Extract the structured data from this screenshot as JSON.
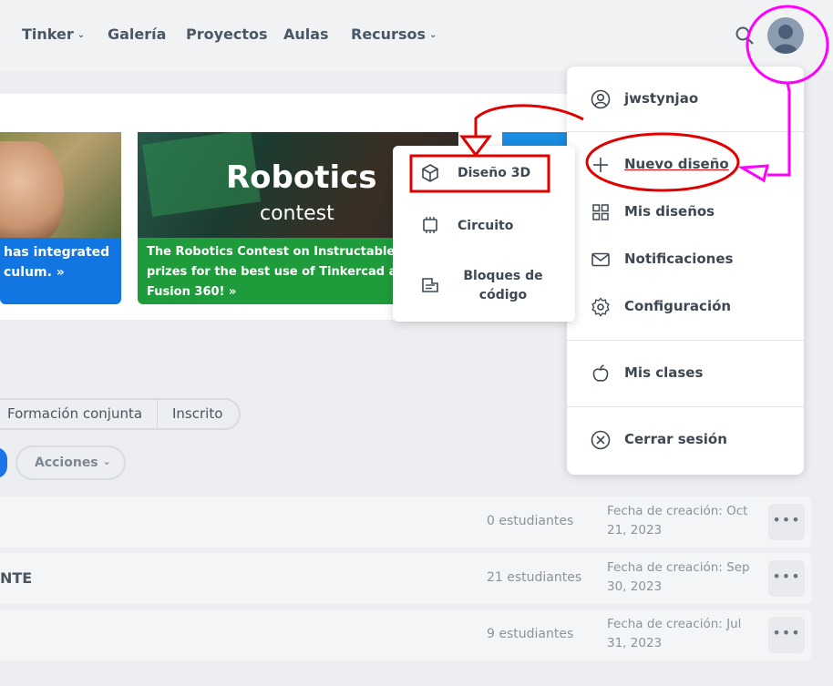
{
  "nav": {
    "items": [
      {
        "label": "Tinker",
        "has_chevron": true
      },
      {
        "label": "Galería",
        "has_chevron": false
      },
      {
        "label": "Proyectos",
        "has_chevron": false
      },
      {
        "label": "Aulas",
        "has_chevron": false
      },
      {
        "label": "Recursos",
        "has_chevron": true
      }
    ],
    "search_icon": "search-icon",
    "avatar_icon": "user-avatar"
  },
  "banners": {
    "card1": {
      "caption": "has integrated culum. »"
    },
    "card2": {
      "title": "Robotics",
      "subtitle": "contest",
      "caption": "The Robotics Contest on Instructables has prizes for the best use of Tinkercad and Fusion 360! »"
    }
  },
  "filters": {
    "tabs": [
      "Formación conjunta",
      "Inscrito"
    ],
    "actions_label": "Acciones"
  },
  "classes": [
    {
      "name": "",
      "students": "0 estudiantes",
      "date": "Fecha de creación: Oct 21, 2023",
      "more": "•••"
    },
    {
      "name": "NTE",
      "students": "21 estudiantes",
      "date": "Fecha de creación: Sep 30, 2023",
      "more": "•••"
    },
    {
      "name": "",
      "students": "9 estudiantes",
      "date": "Fecha de creación: Jul 31, 2023",
      "more": "•••"
    }
  ],
  "user_menu": {
    "username": "jwstynjao",
    "new_design": "Nuevo diseño",
    "my_designs": "Mis diseños",
    "notifications": "Notificaciones",
    "settings": "Configuración",
    "my_classes": "Mis clases",
    "logout": "Cerrar sesión"
  },
  "new_design_submenu": {
    "design_3d": "Diseño 3D",
    "circuit": "Circuito",
    "codeblocks": "Bloques de código"
  },
  "colors": {
    "annotation_red": "#e00000",
    "annotation_magenta": "#ff00ff",
    "caption_blue": "#1276e2",
    "caption_green": "#1e9b3b"
  }
}
